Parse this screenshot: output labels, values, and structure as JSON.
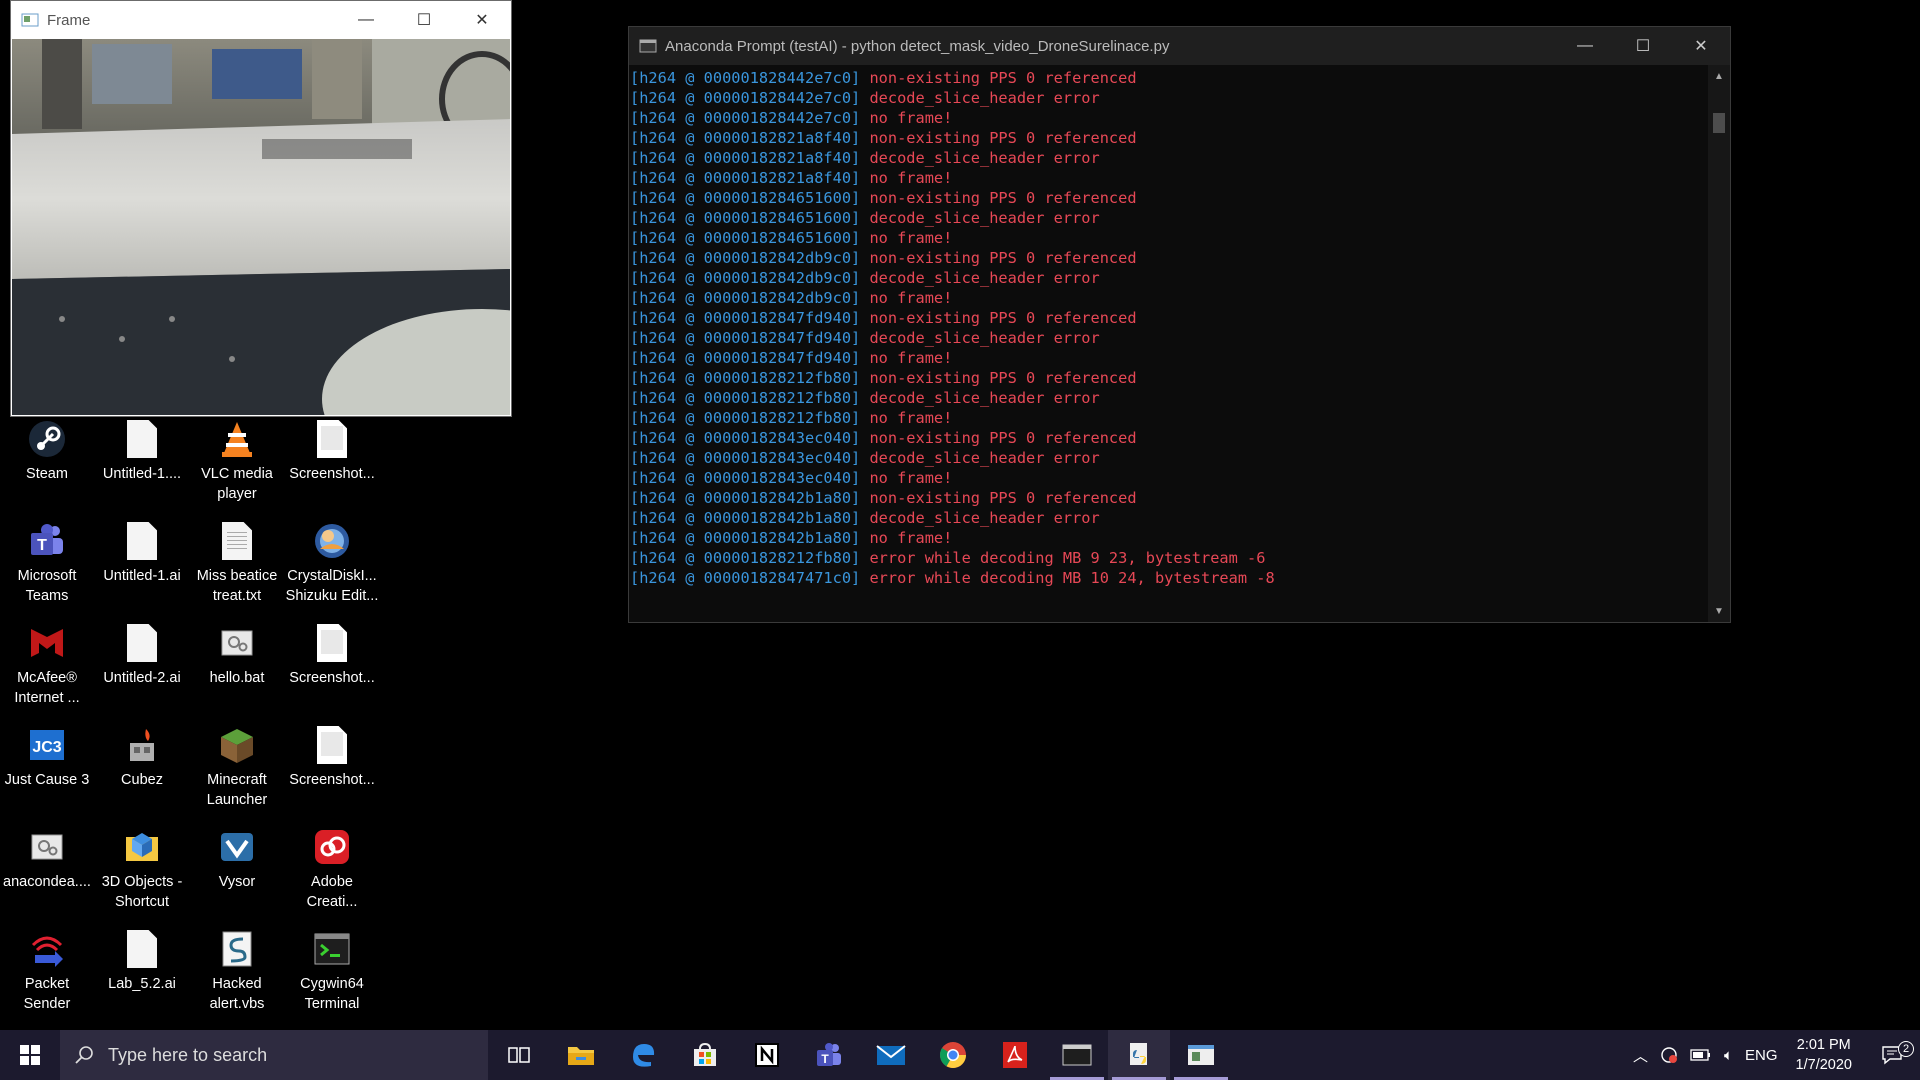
{
  "frame_window": {
    "title": "Frame",
    "controls": {
      "minimize": "—",
      "maximize": "☐",
      "close": "✕"
    }
  },
  "conda_window": {
    "title": "Anaconda Prompt (testAI) - python  detect_mask_video_DroneSurelinace.py",
    "controls": {
      "minimize": "—",
      "maximize": "☐",
      "close": "✕"
    },
    "lines": [
      {
        "addr": "[h264 @ 000001828442e7c0]",
        "msg": "non-existing PPS 0 referenced"
      },
      {
        "addr": "[h264 @ 000001828442e7c0]",
        "msg": "decode_slice_header error"
      },
      {
        "addr": "[h264 @ 000001828442e7c0]",
        "msg": "no frame!"
      },
      {
        "addr": "[h264 @ 00000182821a8f40]",
        "msg": "non-existing PPS 0 referenced"
      },
      {
        "addr": "[h264 @ 00000182821a8f40]",
        "msg": "decode_slice_header error"
      },
      {
        "addr": "[h264 @ 00000182821a8f40]",
        "msg": "no frame!"
      },
      {
        "addr": "[h264 @ 0000018284651600]",
        "msg": "non-existing PPS 0 referenced"
      },
      {
        "addr": "[h264 @ 0000018284651600]",
        "msg": "decode_slice_header error"
      },
      {
        "addr": "[h264 @ 0000018284651600]",
        "msg": "no frame!"
      },
      {
        "addr": "[h264 @ 00000182842db9c0]",
        "msg": "non-existing PPS 0 referenced"
      },
      {
        "addr": "[h264 @ 00000182842db9c0]",
        "msg": "decode_slice_header error"
      },
      {
        "addr": "[h264 @ 00000182842db9c0]",
        "msg": "no frame!"
      },
      {
        "addr": "[h264 @ 00000182847fd940]",
        "msg": "non-existing PPS 0 referenced"
      },
      {
        "addr": "[h264 @ 00000182847fd940]",
        "msg": "decode_slice_header error"
      },
      {
        "addr": "[h264 @ 00000182847fd940]",
        "msg": "no frame!"
      },
      {
        "addr": "[h264 @ 000001828212fb80]",
        "msg": "non-existing PPS 0 referenced"
      },
      {
        "addr": "[h264 @ 000001828212fb80]",
        "msg": "decode_slice_header error"
      },
      {
        "addr": "[h264 @ 000001828212fb80]",
        "msg": "no frame!"
      },
      {
        "addr": "[h264 @ 00000182843ec040]",
        "msg": "non-existing PPS 0 referenced"
      },
      {
        "addr": "[h264 @ 00000182843ec040]",
        "msg": "decode_slice_header error"
      },
      {
        "addr": "[h264 @ 00000182843ec040]",
        "msg": "no frame!"
      },
      {
        "addr": "[h264 @ 00000182842b1a80]",
        "msg": "non-existing PPS 0 referenced"
      },
      {
        "addr": "[h264 @ 00000182842b1a80]",
        "msg": "decode_slice_header error"
      },
      {
        "addr": "[h264 @ 00000182842b1a80]",
        "msg": "no frame!"
      },
      {
        "addr": "[h264 @ 000001828212fb80]",
        "msg": "error while decoding MB 9 23, bytestream -6"
      },
      {
        "addr": "[h264 @ 00000182847471c0]",
        "msg": "error while decoding MB 10 24, bytestream -8"
      }
    ]
  },
  "desktop": {
    "icons": [
      {
        "label": "Steam",
        "icon": "steam-icon"
      },
      {
        "label": "Untitled-1....",
        "icon": "file-icon"
      },
      {
        "label": "VLC media player",
        "icon": "vlc-icon"
      },
      {
        "label": "Screenshot...",
        "icon": "image-file-icon"
      },
      {
        "label": "Microsoft Teams",
        "icon": "teams-icon"
      },
      {
        "label": "Untitled-1.ai",
        "icon": "file-icon"
      },
      {
        "label": "Miss beatice treat.txt",
        "icon": "text-file-icon"
      },
      {
        "label": "CrystalDiskI... Shizuku Edit...",
        "icon": "crystaldisk-icon"
      },
      {
        "label": "McAfee® Internet ...",
        "icon": "mcafee-icon"
      },
      {
        "label": "Untitled-2.ai",
        "icon": "file-icon"
      },
      {
        "label": "hello.bat",
        "icon": "batch-file-icon"
      },
      {
        "label": "Screenshot...",
        "icon": "image-file-icon"
      },
      {
        "label": "Just Cause 3",
        "icon": "just-cause-icon"
      },
      {
        "label": "Cubez",
        "icon": "cubez-icon"
      },
      {
        "label": "Minecraft Launcher",
        "icon": "minecraft-icon"
      },
      {
        "label": "Screenshot...",
        "icon": "image-file-icon"
      },
      {
        "label": "anacondea....",
        "icon": "batch-file-icon"
      },
      {
        "label": "3D Objects - Shortcut",
        "icon": "folder-3d-icon"
      },
      {
        "label": "Vysor",
        "icon": "vysor-icon"
      },
      {
        "label": "Adobe Creati...",
        "icon": "creative-cloud-icon"
      },
      {
        "label": "Packet Sender",
        "icon": "packet-sender-icon"
      },
      {
        "label": "Lab_5.2.ai",
        "icon": "file-icon"
      },
      {
        "label": "Hacked alert.vbs",
        "icon": "vbs-script-icon"
      },
      {
        "label": "Cygwin64 Terminal",
        "icon": "cygwin-icon"
      }
    ]
  },
  "taskbar": {
    "search_placeholder": "Type here to search",
    "apps": [
      {
        "name": "task-view",
        "icon": "task-view-icon"
      },
      {
        "name": "file-explorer",
        "icon": "folder-icon"
      },
      {
        "name": "edge",
        "icon": "edge-icon"
      },
      {
        "name": "store",
        "icon": "store-icon"
      },
      {
        "name": "notion",
        "icon": "notion-icon"
      },
      {
        "name": "teams",
        "icon": "teams-icon"
      },
      {
        "name": "mail",
        "icon": "mail-icon"
      },
      {
        "name": "chrome",
        "icon": "chrome-icon"
      },
      {
        "name": "acrobat",
        "icon": "acrobat-icon"
      },
      {
        "name": "terminal",
        "icon": "terminal-icon"
      },
      {
        "name": "python",
        "icon": "python-icon"
      },
      {
        "name": "frame-window",
        "icon": "window-icon"
      }
    ],
    "language": "ENG",
    "time": "2:01 PM",
    "date": "1/7/2020",
    "notification_count": "2"
  }
}
